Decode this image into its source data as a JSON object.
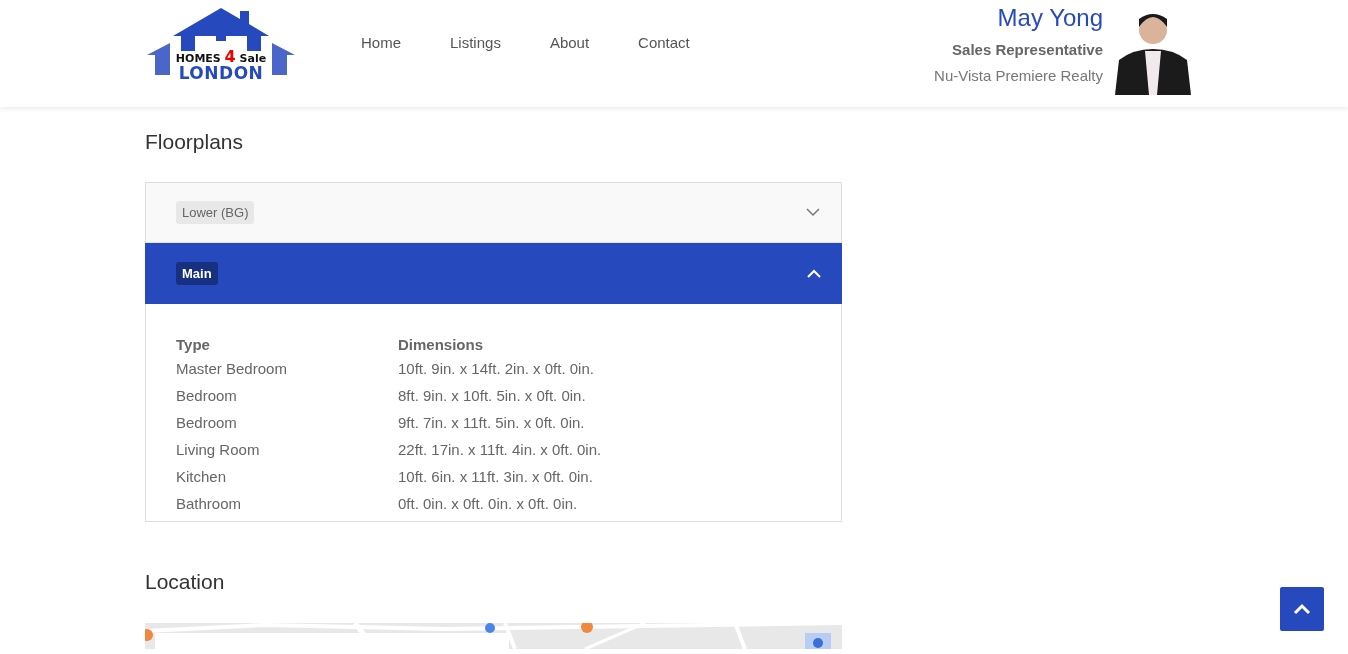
{
  "logo": {
    "line_1": "HOMES",
    "number": "4",
    "line_1_end": "Sale",
    "line_2": "LONDON"
  },
  "nav": [
    {
      "label": "Home"
    },
    {
      "label": "Listings"
    },
    {
      "label": "About"
    },
    {
      "label": "Contact"
    }
  ],
  "agent": {
    "name": "May Yong",
    "title": "Sales Representative",
    "company": "Nu-Vista Premiere Realty"
  },
  "floorplans": {
    "heading": "Floorplans",
    "panels": [
      {
        "label": "Lower (BG)",
        "expanded": false
      },
      {
        "label": "Main",
        "expanded": true,
        "columns": [
          "Type",
          "Dimensions"
        ],
        "rows": [
          [
            "Master Bedroom",
            "10ft. 9in. x 14ft. 2in. x 0ft. 0in."
          ],
          [
            "Bedroom",
            "8ft. 9in. x 10ft. 5in. x 0ft. 0in."
          ],
          [
            "Bedroom",
            "9ft. 7in. x 11ft. 5in. x 0ft. 0in."
          ],
          [
            "Living Room",
            "22ft. 17in. x 11ft. 4in. x 0ft. 0in."
          ],
          [
            "Kitchen",
            "10ft. 6in. x 11ft. 3in. x 0ft. 0in."
          ],
          [
            "Bathroom",
            "0ft. 0in. x 0ft. 0in. x 0ft. 0in."
          ]
        ]
      }
    ]
  },
  "location": {
    "heading": "Location"
  }
}
